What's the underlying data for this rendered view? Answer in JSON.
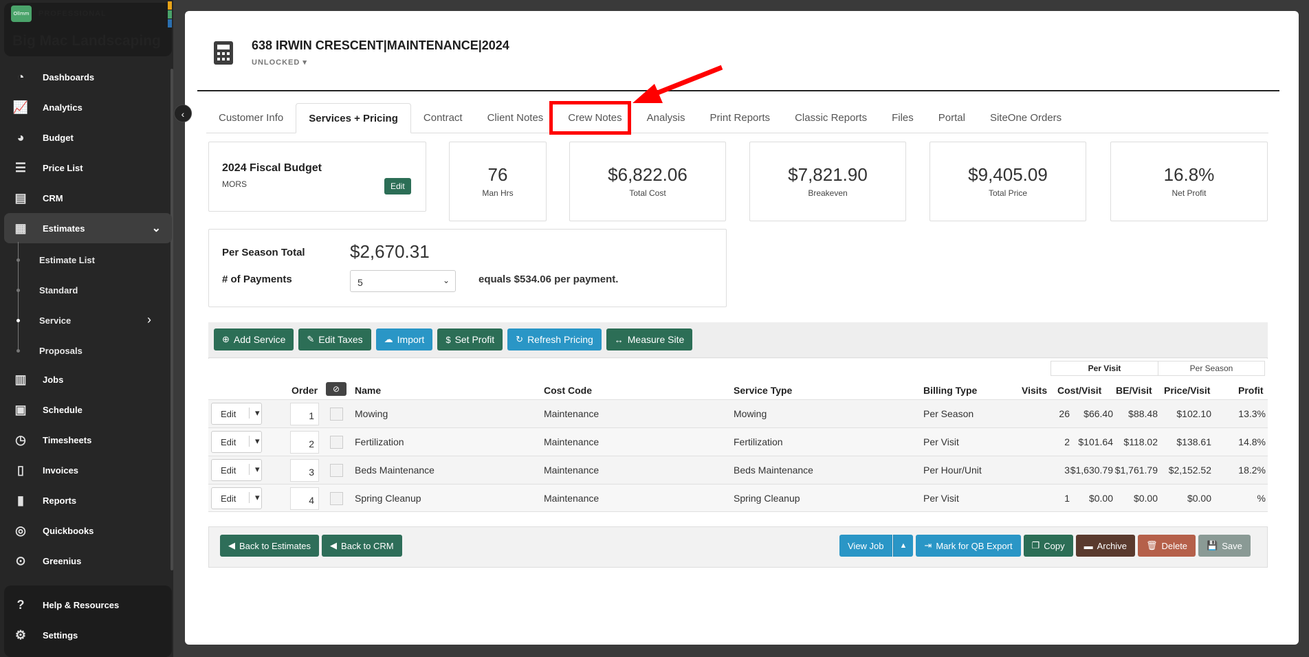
{
  "app": {
    "edition": "PROFESSIONAL",
    "logo_text": "Ollmm",
    "company": "Big Mac Landscaping",
    "brand_colors": [
      "#e8a317",
      "#4aa36a",
      "#2a6fb0"
    ]
  },
  "nav": {
    "dashboards": "Dashboards",
    "analytics": "Analytics",
    "budget": "Budget",
    "price_list": "Price List",
    "crm": "CRM",
    "estimates": "Estimates",
    "estimate_list": "Estimate List",
    "standard": "Standard",
    "service": "Service",
    "proposals": "Proposals",
    "jobs": "Jobs",
    "schedule": "Schedule",
    "timesheets": "Timesheets",
    "invoices": "Invoices",
    "reports": "Reports",
    "quickbooks": "Quickbooks",
    "greenius": "Greenius",
    "help": "Help & Resources",
    "settings": "Settings"
  },
  "header": {
    "title": "638 IRWIN CRESCENT|MAINTENANCE|2024",
    "status": "UNLOCKED"
  },
  "tabs": [
    "Customer Info",
    "Services + Pricing",
    "Contract",
    "Client Notes",
    "Crew Notes",
    "Analysis",
    "Print Reports",
    "Classic Reports",
    "Files",
    "Portal",
    "SiteOne Orders"
  ],
  "budget": {
    "title": "2024 Fiscal Budget",
    "code": "MORS",
    "edit_label": "Edit"
  },
  "stats": [
    {
      "value": "76",
      "label": "Man Hrs"
    },
    {
      "value": "$6,822.06",
      "label": "Total Cost"
    },
    {
      "value": "$7,821.90",
      "label": "Breakeven"
    },
    {
      "value": "$9,405.09",
      "label": "Total Price"
    },
    {
      "value": "16.8%",
      "label": "Net Profit"
    }
  ],
  "season": {
    "total_label": "Per Season Total",
    "total_value": "$2,670.31",
    "payments_label": "# of Payments",
    "payments_value": "5",
    "equals_text": "equals $534.06 per payment."
  },
  "toolbar": {
    "add_service": "Add Service",
    "edit_taxes": "Edit Taxes",
    "import": "Import",
    "set_profit": "Set Profit",
    "refresh_pricing": "Refresh Pricing",
    "measure_site": "Measure Site"
  },
  "toggle": {
    "per_visit": "Per Visit",
    "per_season": "Per Season"
  },
  "columns": {
    "order": "Order",
    "name": "Name",
    "cost_code": "Cost Code",
    "service_type": "Service Type",
    "billing_type": "Billing Type",
    "visits": "Visits",
    "cost_visit": "Cost/Visit",
    "be_visit": "BE/Visit",
    "price_visit": "Price/Visit",
    "profit": "Profit"
  },
  "rows": [
    {
      "edit": "Edit",
      "order": "1",
      "name": "Mowing",
      "cost_code": "Maintenance",
      "service_type": "Mowing",
      "billing_type": "Per Season",
      "visits": "26",
      "cost_visit": "$66.40",
      "be_visit": "$88.48",
      "price_visit": "$102.10",
      "profit": "13.3%"
    },
    {
      "edit": "Edit",
      "order": "2",
      "name": "Fertilization",
      "cost_code": "Maintenance",
      "service_type": "Fertilization",
      "billing_type": "Per Visit",
      "visits": "2",
      "cost_visit": "$101.64",
      "be_visit": "$118.02",
      "price_visit": "$138.61",
      "profit": "14.8%"
    },
    {
      "edit": "Edit",
      "order": "3",
      "name": "Beds Maintenance",
      "cost_code": "Maintenance",
      "service_type": "Beds Maintenance",
      "billing_type": "Per Hour/Unit",
      "visits": "3",
      "cost_visit": "$1,630.79",
      "be_visit": "$1,761.79",
      "price_visit": "$2,152.52",
      "profit": "18.2%"
    },
    {
      "edit": "Edit",
      "order": "4",
      "name": "Spring Cleanup",
      "cost_code": "Maintenance",
      "service_type": "Spring Cleanup",
      "billing_type": "Per Visit",
      "visits": "1",
      "cost_visit": "$0.00",
      "be_visit": "$0.00",
      "price_visit": "$0.00",
      "profit": "%"
    }
  ],
  "footer": {
    "back_estimates": "Back to Estimates",
    "back_crm": "Back to CRM",
    "view_job": "View Job",
    "mark_qb": "Mark for QB Export",
    "copy": "Copy",
    "archive": "Archive",
    "delete": "Delete",
    "save": "Save"
  },
  "colors": {
    "green": "#2c6e56",
    "blue": "#2a96c6",
    "archive": "#5a3a2e",
    "delete": "#b5604a",
    "save": "#8a9a95",
    "highlight": "#ff0000"
  }
}
